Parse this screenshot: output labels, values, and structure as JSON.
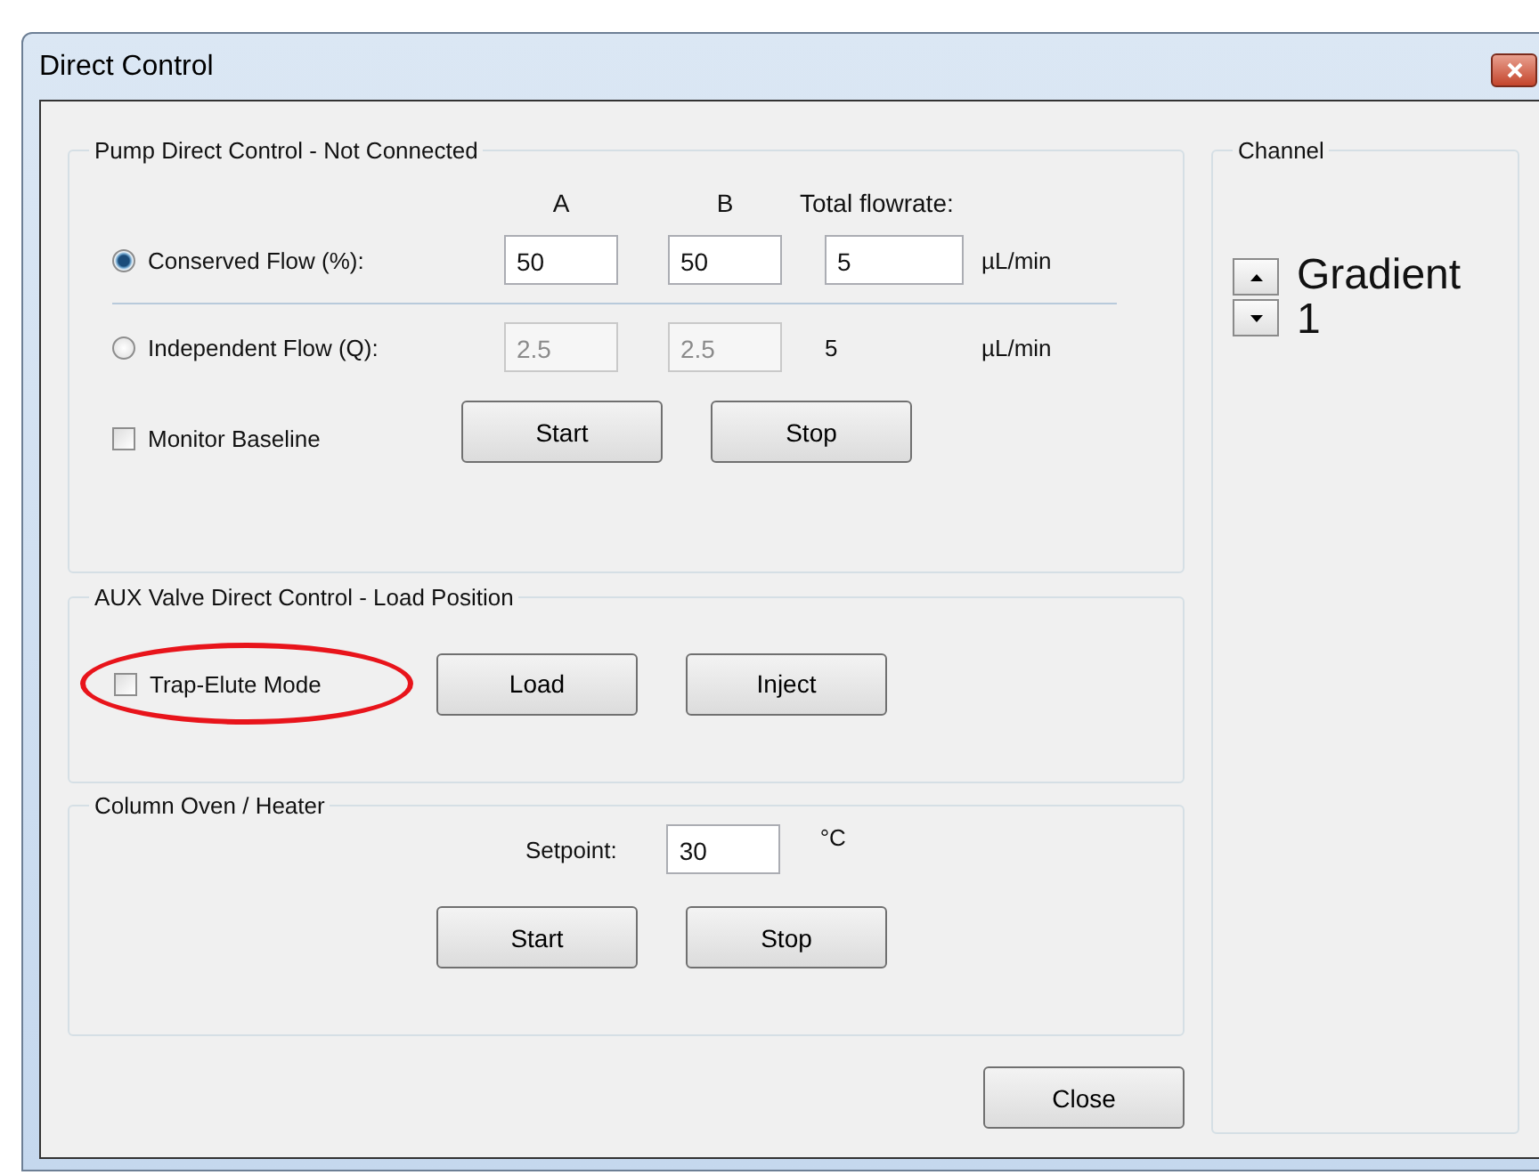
{
  "window": {
    "title": "Direct Control"
  },
  "pump": {
    "title": "Pump Direct Control - Not Connected",
    "column_headers": [
      "A",
      "B",
      "Total flowrate:"
    ],
    "modes": [
      {
        "label": "Conserved Flow (%):",
        "selected": true,
        "disabled": false,
        "a": "50",
        "b": "50",
        "total": "5",
        "total_editable": true,
        "unit": "µL/min"
      },
      {
        "label": "Independent Flow (Q):",
        "selected": false,
        "disabled": true,
        "a": "2.5",
        "b": "2.5",
        "total": "5",
        "total_editable": false,
        "unit": "µL/min"
      }
    ],
    "monitor": {
      "label": "Monitor Baseline",
      "checked": false
    },
    "buttons": [
      "Start",
      "Stop"
    ]
  },
  "aux": {
    "title": "AUX Valve Direct Control - Load Position",
    "checkbox": {
      "label": "Trap-Elute Mode",
      "checked": false,
      "circled": true
    },
    "buttons": [
      "Load",
      "Inject"
    ]
  },
  "oven": {
    "title": "Column Oven / Heater",
    "setpoint_label": "Setpoint:",
    "setpoint": "30",
    "unit": "°C",
    "buttons": [
      "Start",
      "Stop"
    ]
  },
  "channel": {
    "title": "Channel",
    "value": "Gradient 1"
  },
  "close": "Close"
}
